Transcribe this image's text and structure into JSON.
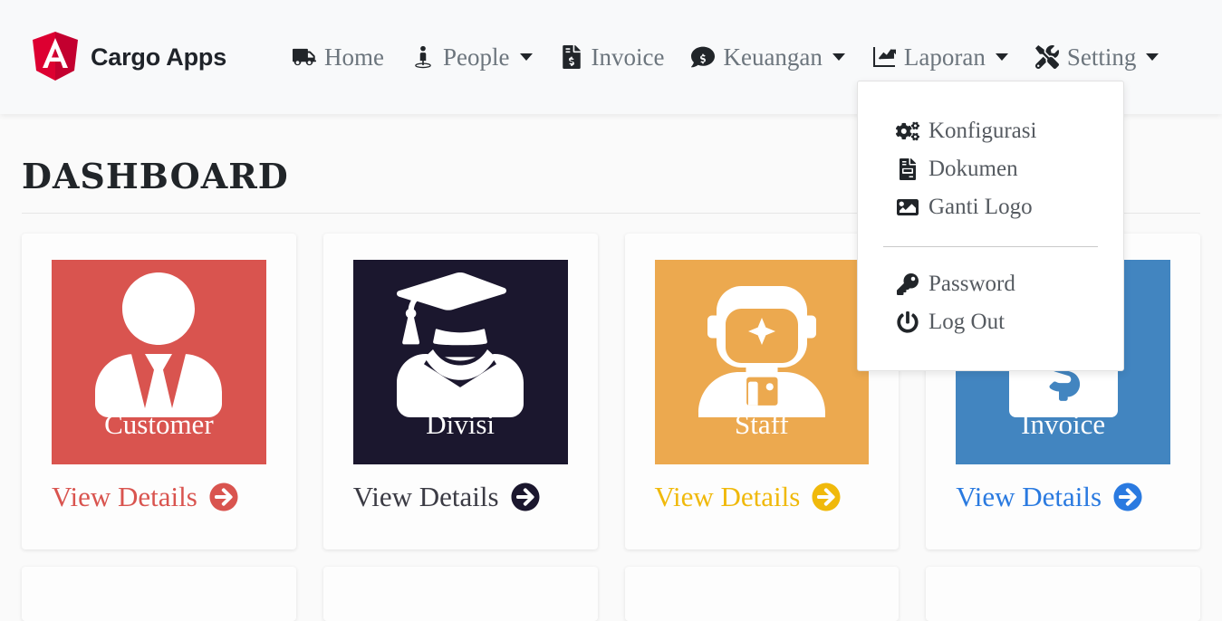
{
  "navbar": {
    "brand": {
      "label": "Cargo Apps",
      "logo_icon": "angular-shield-icon",
      "logo_color": "#dd0031"
    },
    "background": "#f8f9fa",
    "items": [
      {
        "label": "Home",
        "icon": "truck-icon",
        "has_caret": false
      },
      {
        "label": "People",
        "icon": "user-pedestal-icon",
        "has_caret": true
      },
      {
        "label": "Invoice",
        "icon": "file-invoice-dollar-icon",
        "has_caret": false
      },
      {
        "label": "Keuangan",
        "icon": "comment-dollar-icon",
        "has_caret": true
      },
      {
        "label": "Laporan",
        "icon": "chart-line-square-icon",
        "has_caret": true
      },
      {
        "label": "Setting",
        "icon": "screwdriver-wrench-icon",
        "has_caret": true
      }
    ]
  },
  "setting_dropdown": {
    "open": true,
    "items": [
      {
        "label": "Konfigurasi",
        "icon": "cogs-icon"
      },
      {
        "label": "Dokumen",
        "icon": "file-invoice-icon"
      },
      {
        "label": "Ganti Logo",
        "icon": "image-icon"
      },
      {
        "label": "Password",
        "icon": "key-icon"
      },
      {
        "label": "Log Out",
        "icon": "power-off-icon"
      }
    ],
    "divider_after_index": 2
  },
  "main": {
    "title": "Dashboard",
    "cards": [
      {
        "label": "Customer",
        "icon": "user-tie-icon",
        "color": "#d9544f",
        "link_label": "View Details",
        "link_icon": "arrow-circle-right-icon"
      },
      {
        "label": "Divisi",
        "icon": "user-graduate-icon",
        "color": "#1b172e",
        "link_label": "View Details",
        "link_icon": "arrow-circle-right-icon"
      },
      {
        "label": "Staff",
        "icon": "user-astronaut-icon",
        "color": "#eca94f",
        "link_label": "View Details",
        "link_icon": "arrow-circle-right-icon",
        "link_color": "#f0b90b"
      },
      {
        "label": "Invoice",
        "icon": "file-invoice-dollar-icon",
        "color": "#4285c0",
        "link_label": "View Details",
        "link_icon": "arrow-circle-right-icon",
        "link_color": "#2a7ae0"
      }
    ]
  }
}
